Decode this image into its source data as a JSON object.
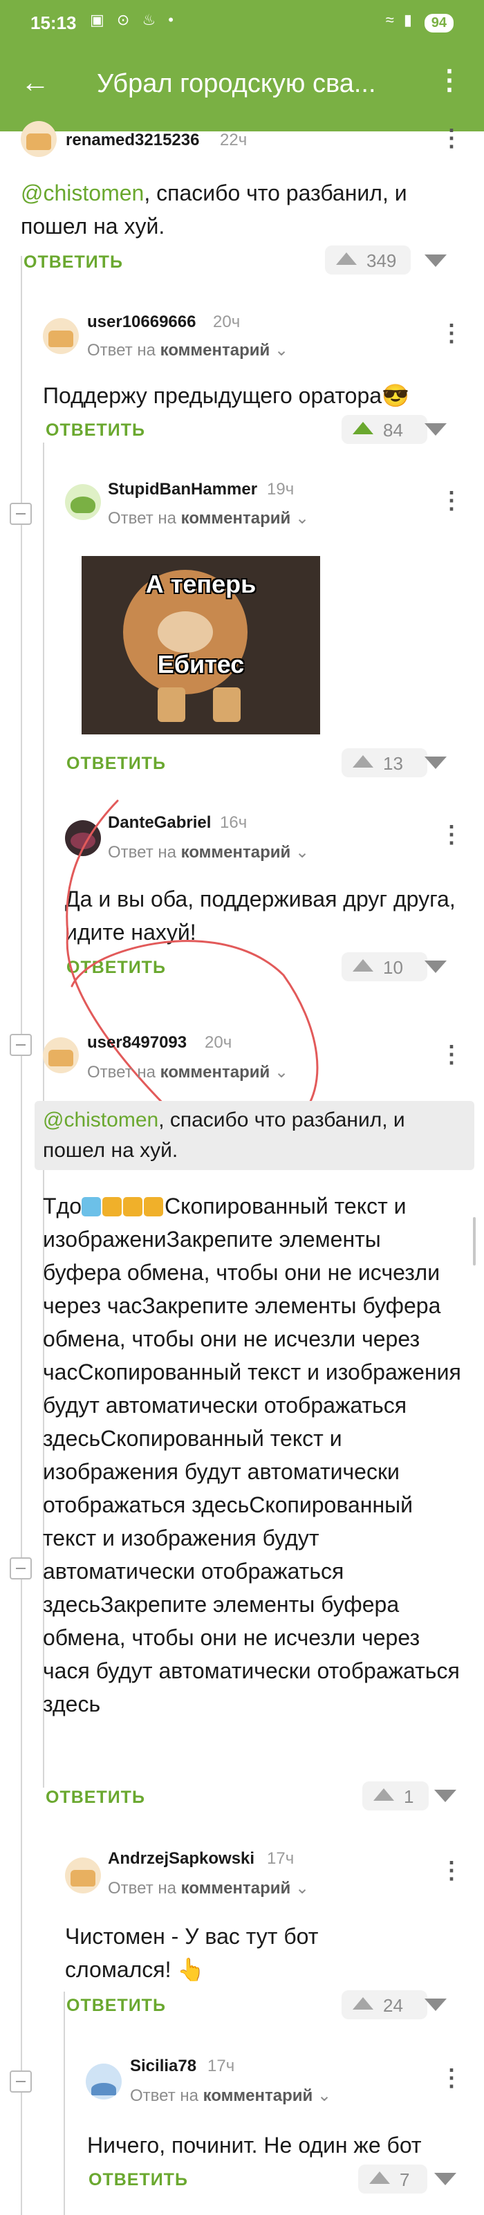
{
  "status_bar": {
    "time": "15:13",
    "left_icons": "▣ ⊙ ♨ •",
    "right_icons": "≈ ▮",
    "battery": "94"
  },
  "app_bar": {
    "title": "Убрал городскую сва..."
  },
  "reply_label": "ОТВЕТИТЬ",
  "reply_to_prefix": "Ответ на",
  "reply_to_target": "комментарий",
  "comments": [
    {
      "user": "renamed3215236",
      "time": "22ч",
      "mention": "@chistomen",
      "text": ", спасибо что разбанил, и пошел на хуй.",
      "votes": "349"
    },
    {
      "user": "user10669666",
      "time": "20ч",
      "text": "Поддержу предыдущего оратора😎",
      "votes": "84"
    },
    {
      "user": "StupidBanHammer",
      "time": "19ч",
      "image_top": "А теперь",
      "image_bottom": "Ебитес",
      "votes": "13"
    },
    {
      "user": "DanteGabriel",
      "time": "16ч",
      "text": "Да и вы оба, поддерживая друг друга, идите нахуй!",
      "votes": "10"
    },
    {
      "user": "user8497093",
      "time": "20ч",
      "quote_mention": "@chistomen",
      "quote_text": ", спасибо что разбанил, и пошел на хуй.",
      "text_prefix": "Тдо",
      "text": "Скопированный текст и изображениЗакрепите элементы буфера обмена, чтобы они не исчезли через часЗакрепите элементы буфера обмена, чтобы они не исчезли через часСкопированный текст и изображения будут автоматически отображаться здесьСкопированный текст и изображения будут автоматически отображаться здесьСкопированный текст и изображения будут автоматически отображаться здесьЗакрепите элементы буфера обмена, чтобы они не исчезли через чася будут автоматически отображаться здесь",
      "votes": "1"
    },
    {
      "user": "AndrzejSapkowski",
      "time": "17ч",
      "text": "Чистомен - У вас тут бот сломался! 👆",
      "votes": "24"
    },
    {
      "user": "Sicilia78",
      "time": "17ч",
      "text": "Ничего, починит. Не один же бот",
      "votes": "7"
    }
  ]
}
